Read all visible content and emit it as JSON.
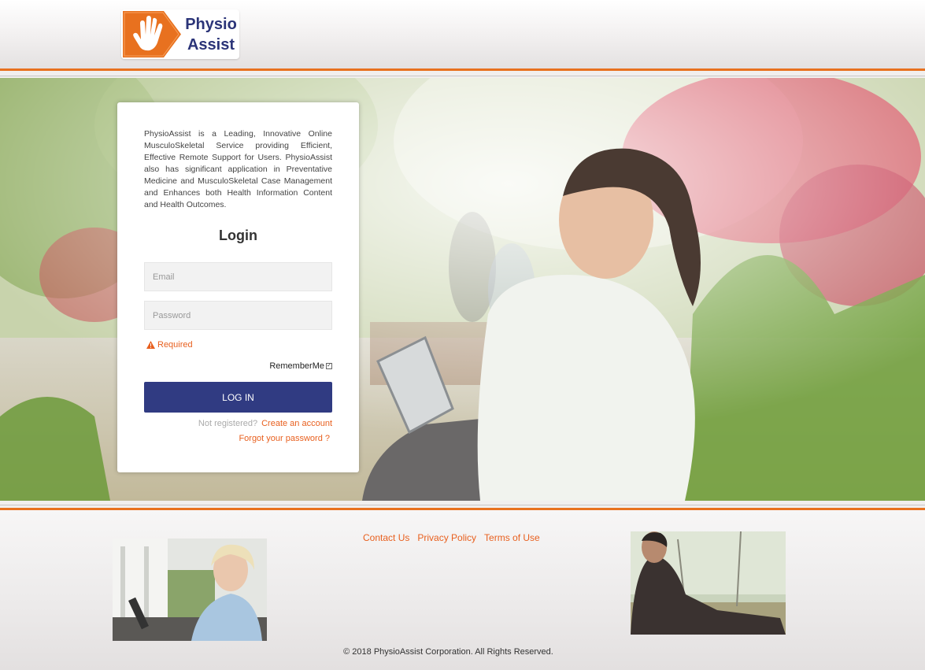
{
  "brand": {
    "line1": "Physio",
    "line2": "Assist",
    "color_blue": "#2b3478",
    "color_orange": "#e8711f"
  },
  "login": {
    "intro": "PhysioAssist is a Leading, Innovative Online MusculoSkeletal Service providing Efficient, Effective Remote Support for Users. PhysioAssist also has significant application in Preventative Medicine and MusculoSkeletal Case Management and Enhances both Health Information Content and Health Outcomes.",
    "title": "Login",
    "email_placeholder": "Email",
    "password_placeholder": "Password",
    "required_text": "Required",
    "remember_label": "RememberMe",
    "remember_checked": true,
    "login_button": "LOG IN",
    "not_registered": "Not registered?",
    "create_account": "Create an account",
    "forgot_password": "Forgot your password ?"
  },
  "footer": {
    "links": [
      "Contact Us",
      "Privacy Policy",
      "Terms of Use"
    ],
    "copyright": "© 2018 PhysioAssist Corporation. All Rights Reserved."
  },
  "colors": {
    "button": "#303b82",
    "link": "#e8601f"
  }
}
